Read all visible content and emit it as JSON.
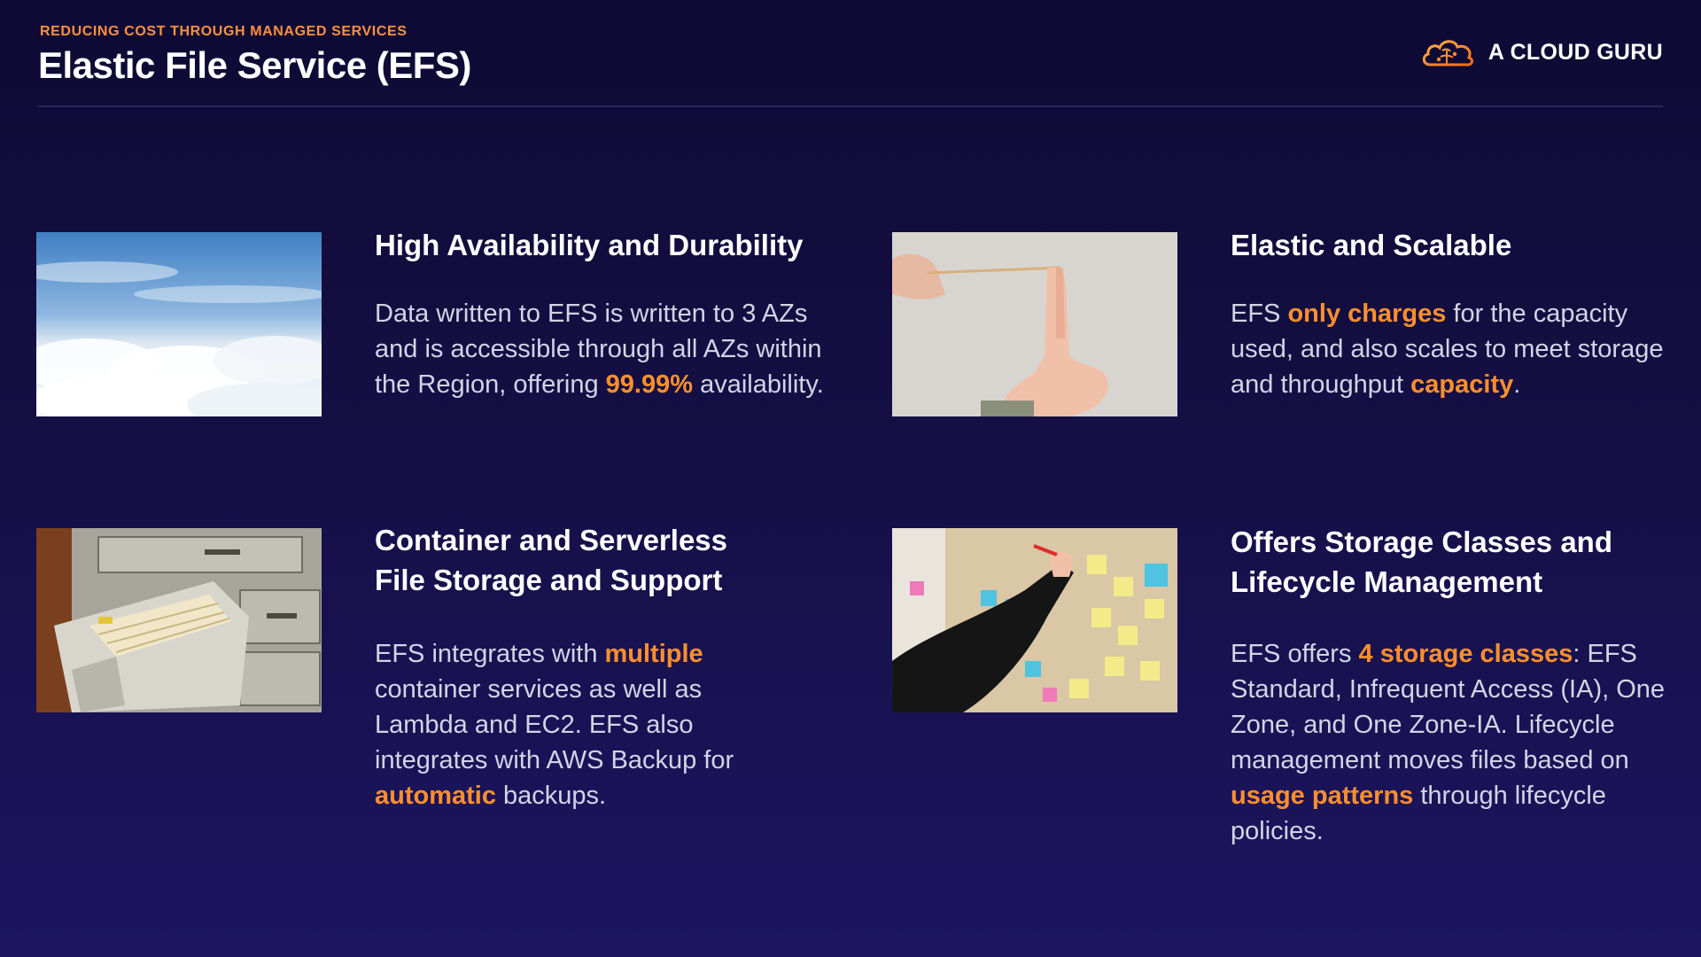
{
  "header": {
    "eyebrow": "REDUCING COST THROUGH MANAGED SERVICES",
    "title": "Elastic File Service (EFS)",
    "brand": "A CLOUD GURU",
    "accent_color": "#ff8f2e"
  },
  "cards": [
    {
      "image_icon": "clouds-sky-photo",
      "heading": [
        "High Availability and Durability"
      ],
      "body": [
        {
          "text": "Data written to EFS is written to 3 AZs and is accessible through all AZs within the Region, offering ",
          "hl": false
        },
        {
          "text": "99.99%",
          "hl": true
        },
        {
          "text": " availability.",
          "hl": false
        }
      ]
    },
    {
      "image_icon": "rubber-band-stretch-photo",
      "heading": [
        "Elastic and Scalable"
      ],
      "body": [
        {
          "text": "EFS ",
          "hl": false
        },
        {
          "text": "only charges",
          "hl": true
        },
        {
          "text": " for the capacity used, and also scales to meet storage and throughput ",
          "hl": false
        },
        {
          "text": "capacity",
          "hl": true
        },
        {
          "text": ".",
          "hl": false
        }
      ]
    },
    {
      "image_icon": "file-cabinet-drawer-photo",
      "heading": [
        "Container and Serverless",
        "File Storage and Support"
      ],
      "body": [
        {
          "text": "EFS integrates with ",
          "hl": false
        },
        {
          "text": "multiple",
          "hl": true
        },
        {
          "text": " container services as well as Lambda and EC2. EFS also integrates with AWS Backup for ",
          "hl": false
        },
        {
          "text": "automatic",
          "hl": true
        },
        {
          "text": " backups.",
          "hl": false
        }
      ]
    },
    {
      "image_icon": "sticky-notes-board-photo",
      "heading": [
        "Offers Storage Classes and",
        "Lifecycle Management"
      ],
      "body": [
        {
          "text": "EFS offers ",
          "hl": false
        },
        {
          "text": "4 storage classes",
          "hl": true
        },
        {
          "text": ": EFS Standard, Infrequent Access (IA), One Zone, and One Zone-IA. Lifecycle management moves files based on ",
          "hl": false
        },
        {
          "text": "usage patterns",
          "hl": true
        },
        {
          "text": " through lifecycle policies.",
          "hl": false
        }
      ]
    }
  ]
}
